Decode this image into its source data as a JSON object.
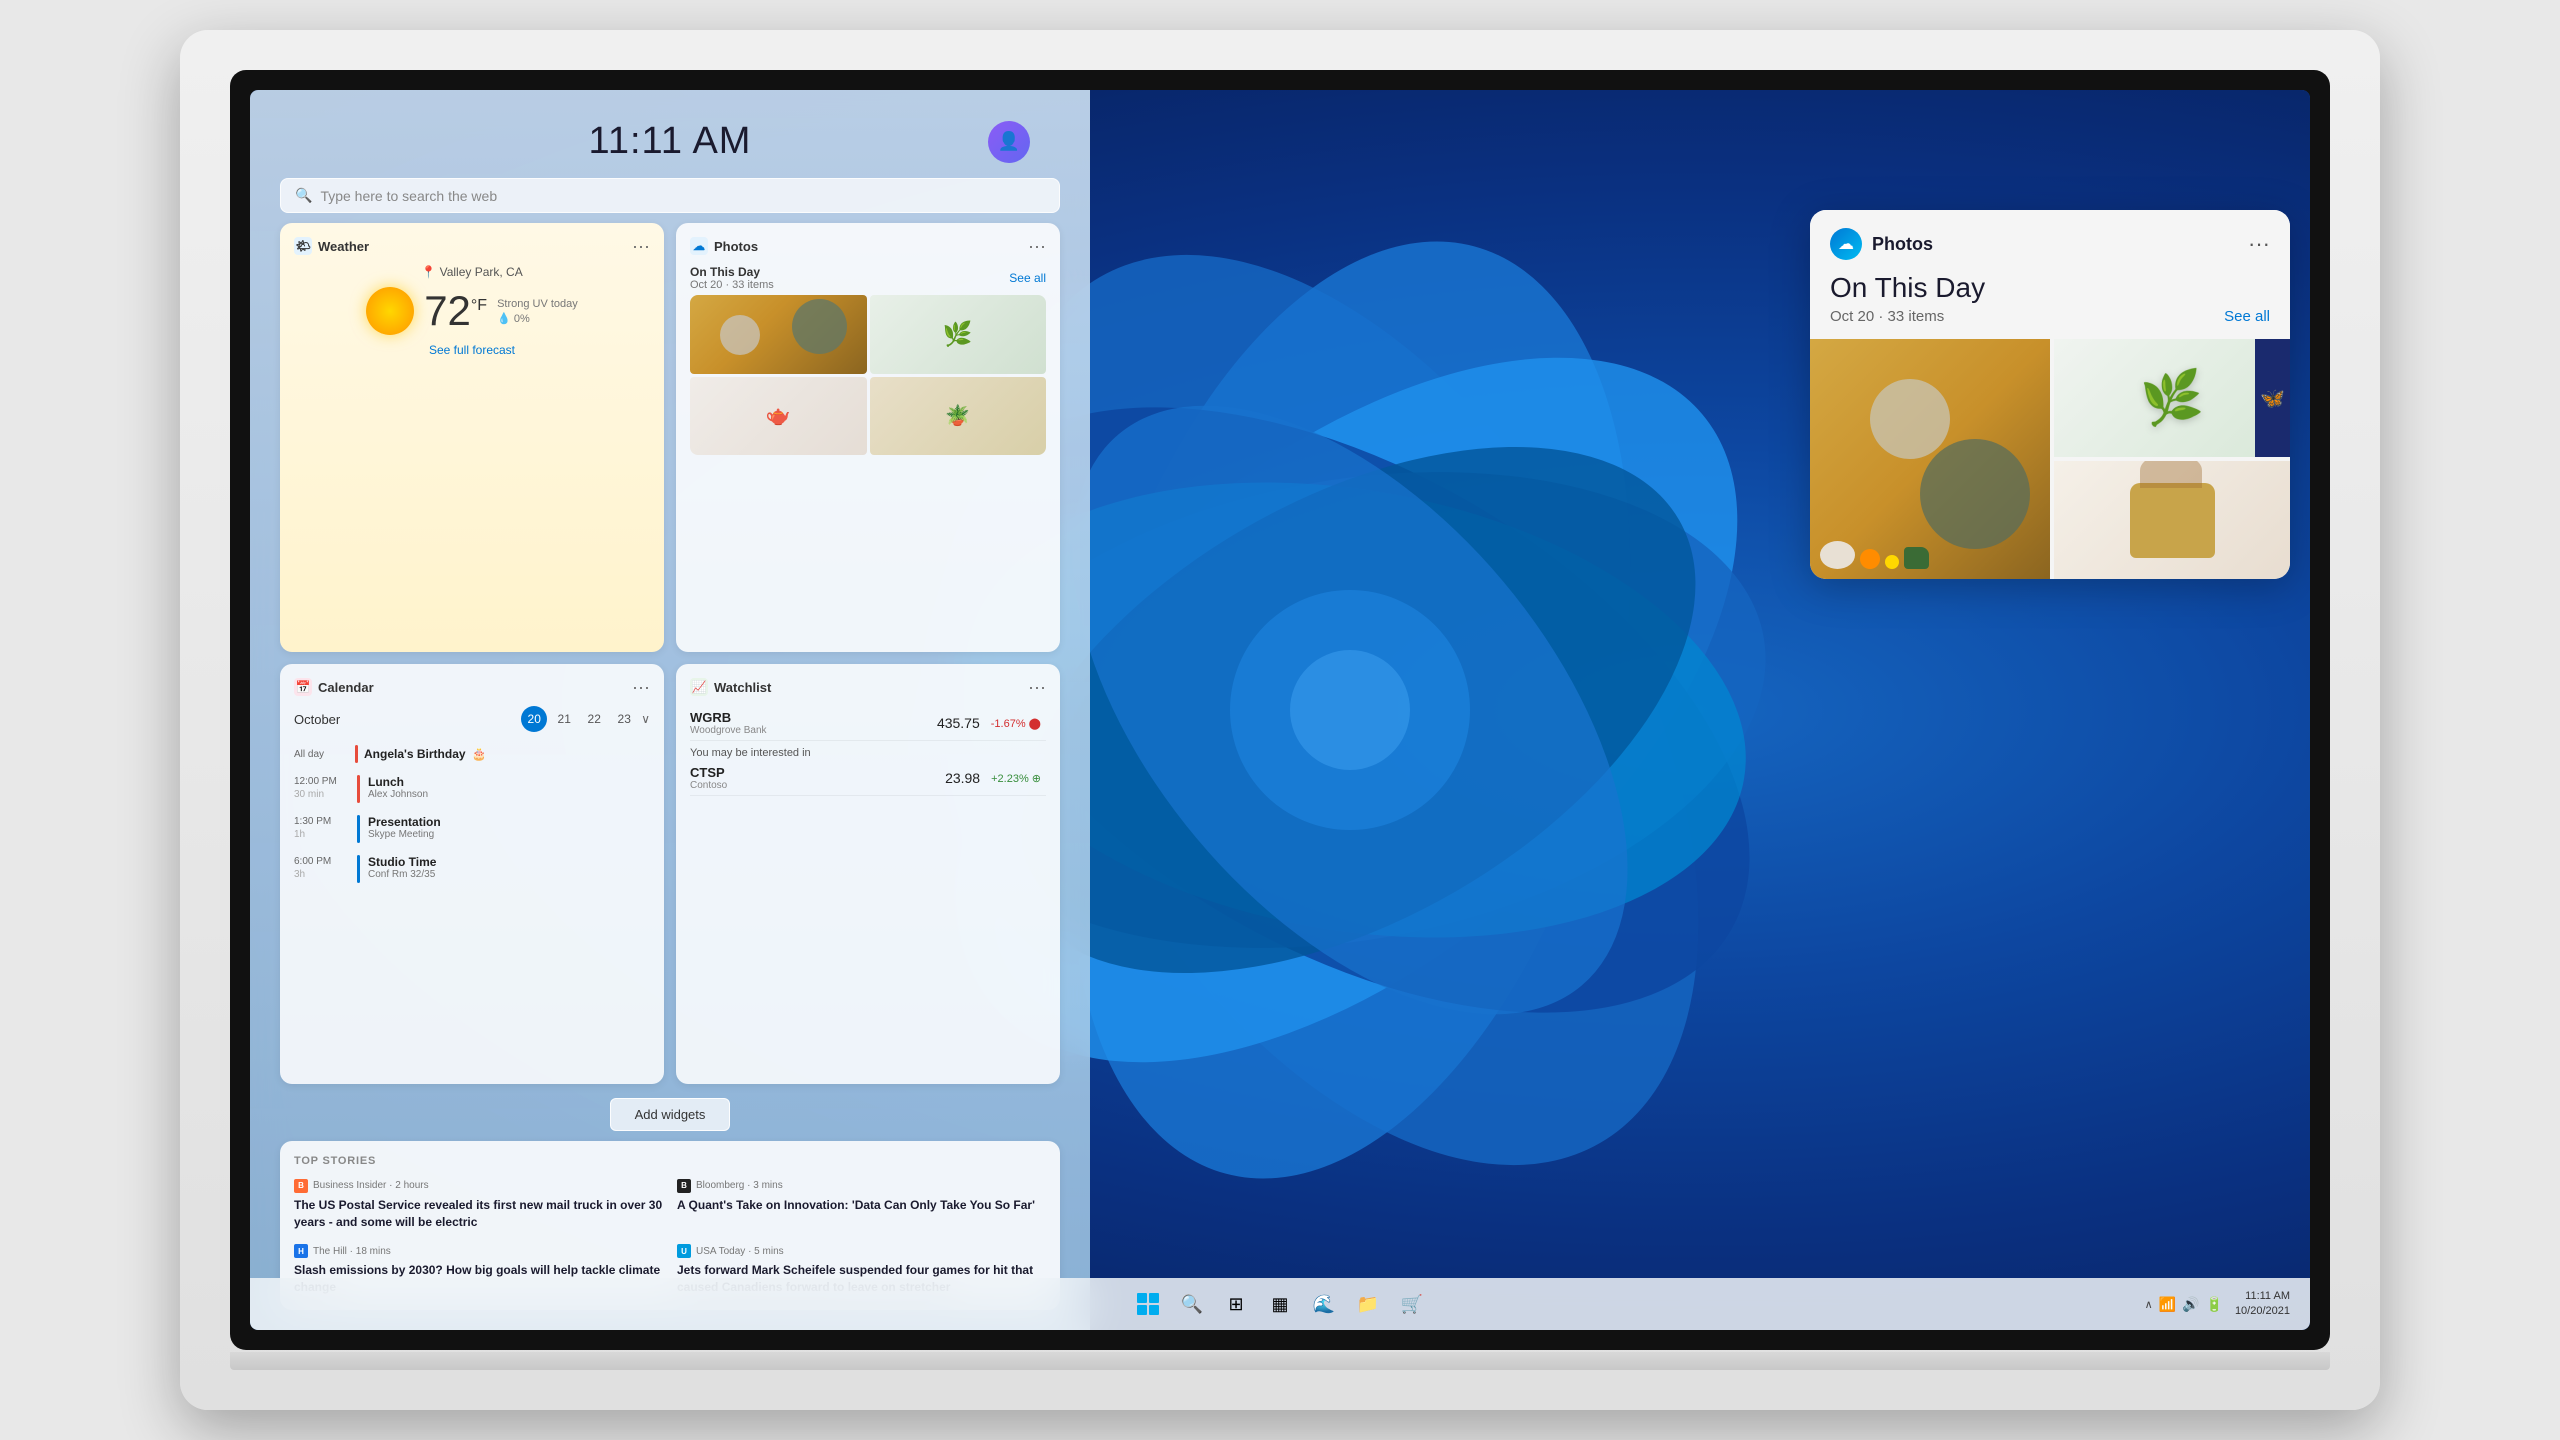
{
  "laptop": {
    "screen": {
      "time": "11:11 AM",
      "date": "10/20/2021"
    }
  },
  "search": {
    "placeholder": "Type here to search the web"
  },
  "weather_widget": {
    "title": "Weather",
    "location": "Valley Park, CA",
    "temperature": "72",
    "unit": "°F",
    "description": "Strong UV today",
    "precipitation": "0%",
    "link": "See full forecast",
    "menu": "···"
  },
  "photos_widget": {
    "title": "Photos",
    "event": "On This Day",
    "date": "Oct 20 · 33 items",
    "see_all": "See all",
    "menu": "···"
  },
  "calendar_widget": {
    "title": "Calendar",
    "month": "October",
    "days": [
      "20",
      "21",
      "22",
      "23"
    ],
    "today": "20",
    "menu": "···",
    "chevron": "∨",
    "events": [
      {
        "time": "All day",
        "duration": "",
        "name": "Angela's Birthday",
        "sub": "",
        "color": "#e74c3c",
        "emoji": "🎂"
      },
      {
        "time": "12:00 PM",
        "duration": "30 min",
        "name": "Lunch",
        "sub": "Alex Johnson",
        "color": "#e74c3c"
      },
      {
        "time": "1:30 PM",
        "duration": "1h",
        "name": "Presentation",
        "sub": "Skype Meeting",
        "color": "#0078d4"
      },
      {
        "time": "6:00 PM",
        "duration": "3h",
        "name": "Studio Time",
        "sub": "Conf Rm 32/35",
        "color": "#0078d4"
      }
    ]
  },
  "watchlist_widget": {
    "title": "Watchlist",
    "menu": "···",
    "stocks": [
      {
        "ticker": "WGRB",
        "name": "Woodgrove Bank",
        "price": "435.75",
        "change": "-1.67%",
        "direction": "negative"
      }
    ],
    "interested_label": "You may be interested in",
    "suggested": [
      {
        "ticker": "CTSP",
        "name": "Contoso",
        "price": "23.98",
        "change": "+2.23%",
        "direction": "positive"
      }
    ]
  },
  "add_widgets": {
    "label": "Add widgets"
  },
  "news": {
    "header": "TOP STORIES",
    "items": [
      {
        "source": "Business Insider",
        "time": "2 hours",
        "source_letter": "B",
        "headline": "The US Postal Service revealed its first new mail truck in over 30 years - and some will be electric"
      },
      {
        "source": "Bloomberg",
        "time": "3 mins",
        "source_letter": "B",
        "headline": "A Quant's Take on Innovation: 'Data Can Only Take You So Far'"
      },
      {
        "source": "The Hill",
        "time": "18 mins",
        "source_letter": "H",
        "headline": "Slash emissions by 2030? How big goals will help tackle climate change"
      },
      {
        "source": "USA Today",
        "time": "5 mins",
        "source_letter": "U",
        "headline": "Jets forward Mark Scheifele suspended four games for hit that caused Canadiens forward to leave on stretcher"
      }
    ]
  },
  "photos_card": {
    "app_name": "Photos",
    "menu": "···",
    "event": "On This Day",
    "date": "Oct 20 · 33 items",
    "see_all": "See all"
  },
  "taskbar": {
    "clock_time": "11:11 AM",
    "clock_date": "10/20/2021"
  }
}
